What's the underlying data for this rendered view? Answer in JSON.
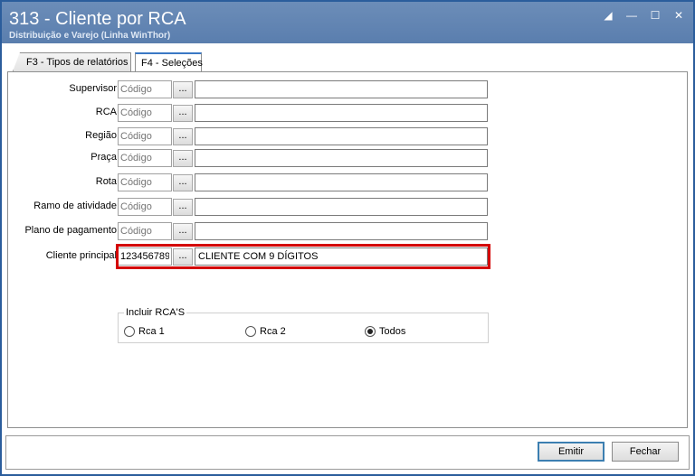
{
  "window": {
    "title": "313 - Cliente por RCA",
    "subtitle": "Distribuição e Varejo (Linha WinThor)"
  },
  "tabs": [
    {
      "label": "F3 - Tipos de relatórios",
      "active": false
    },
    {
      "label": "F4 - Seleções",
      "active": true
    }
  ],
  "filters": [
    {
      "label": "Supervisor",
      "code_placeholder": "Código",
      "code_value": "",
      "description": ""
    },
    {
      "label": "RCA",
      "code_placeholder": "Código",
      "code_value": "",
      "description": ""
    },
    {
      "label": "Região",
      "code_placeholder": "Código",
      "code_value": "",
      "description": ""
    },
    {
      "label": "Praça",
      "code_placeholder": "Código",
      "code_value": "",
      "description": ""
    },
    {
      "label": "Rota",
      "code_placeholder": "Código",
      "code_value": "",
      "description": ""
    },
    {
      "label": "Ramo de atividade",
      "code_placeholder": "Código",
      "code_value": "",
      "description": ""
    },
    {
      "label": "Plano de pagamento",
      "code_placeholder": "Código",
      "code_value": "",
      "description": ""
    },
    {
      "label": "Cliente principal",
      "code_placeholder": "Código",
      "code_value": "123456789",
      "description": "CLIENTE COM 9 DÍGITOS"
    }
  ],
  "lookup_button_label": "...",
  "rca_group": {
    "title": "Incluir RCA'S",
    "options": [
      {
        "label": "Rca 1",
        "checked": false
      },
      {
        "label": "Rca 2",
        "checked": false
      },
      {
        "label": "Todos",
        "checked": true
      }
    ]
  },
  "buttons": {
    "emitir": "Emitir",
    "fechar": "Fechar"
  },
  "colors": {
    "titlebar": "#5a7eae",
    "highlight": "#d40000",
    "active_tab_accent": "#3a78c5"
  }
}
